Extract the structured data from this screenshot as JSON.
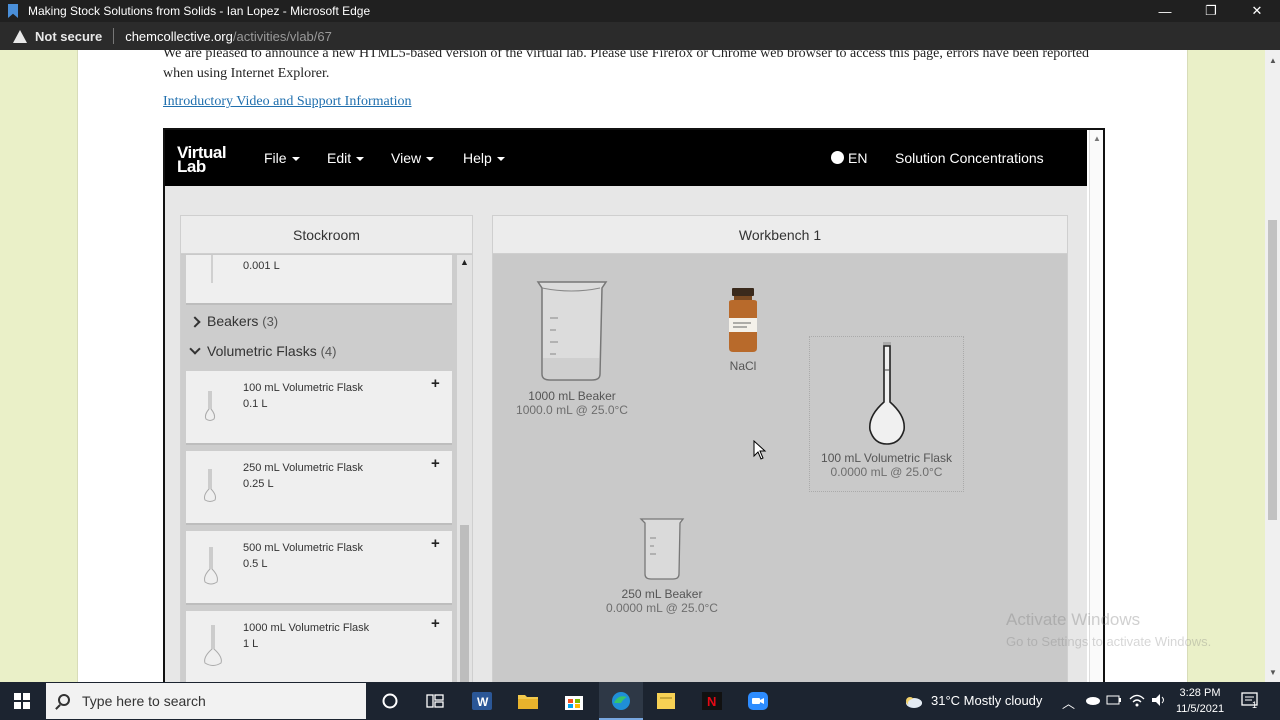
{
  "window": {
    "title": "Making Stock Solutions from Solids - Ian Lopez - Microsoft Edge",
    "minimize": "—",
    "restore": "❐",
    "close": "✕"
  },
  "address": {
    "security": "Not secure",
    "host": "chemcollective.org",
    "path": "/activities/vlab/67"
  },
  "page": {
    "intro_text": "We are pleased to announce a new HTML5-based version of the virtual lab. Please use Firefox or Chrome web browser to access this page, errors have been reported when using Internet Explorer.",
    "intro_link": "Introductory Video and Support Information"
  },
  "vlab": {
    "logo_line1": "Virtual",
    "logo_line2": "Lab",
    "menus": [
      "File",
      "Edit",
      "View",
      "Help"
    ],
    "language": "EN",
    "activity_title": "Solution Concentrations",
    "stockroom": {
      "title": "Stockroom",
      "partial_item_volume": "0.001 L",
      "categories": [
        {
          "label": "Beakers",
          "count": "(3)",
          "expanded": false
        },
        {
          "label": "Volumetric Flasks",
          "count": "(4)",
          "expanded": true
        }
      ],
      "items": [
        {
          "name": "100 mL Volumetric Flask",
          "volume": "0.1 L",
          "add": "+"
        },
        {
          "name": "250 mL Volumetric Flask",
          "volume": "0.25 L",
          "add": "+"
        },
        {
          "name": "500 mL Volumetric Flask",
          "volume": "0.5 L",
          "add": "+"
        },
        {
          "name": "1000 mL Volumetric Flask",
          "volume": "1 L",
          "add": "+"
        }
      ]
    },
    "workbench": {
      "title": "Workbench 1",
      "objects": [
        {
          "name": "1000 mL Beaker",
          "state": "1000.0 mL @ 25.0°C"
        },
        {
          "name": "NaCl",
          "state": ""
        },
        {
          "name": "100 mL Volumetric Flask",
          "state": "0.0000 mL @ 25.0°C"
        },
        {
          "name": "250 mL Beaker",
          "state": "0.0000 mL @ 25.0°C"
        }
      ]
    }
  },
  "watermark": {
    "line1": "Activate Windows",
    "line2": "Go to Settings to activate Windows."
  },
  "taskbar": {
    "search_placeholder": "Type here to search",
    "weather": "31°C  Mostly cloudy",
    "time": "3:28 PM",
    "date": "11/5/2021",
    "notifications": "1"
  }
}
